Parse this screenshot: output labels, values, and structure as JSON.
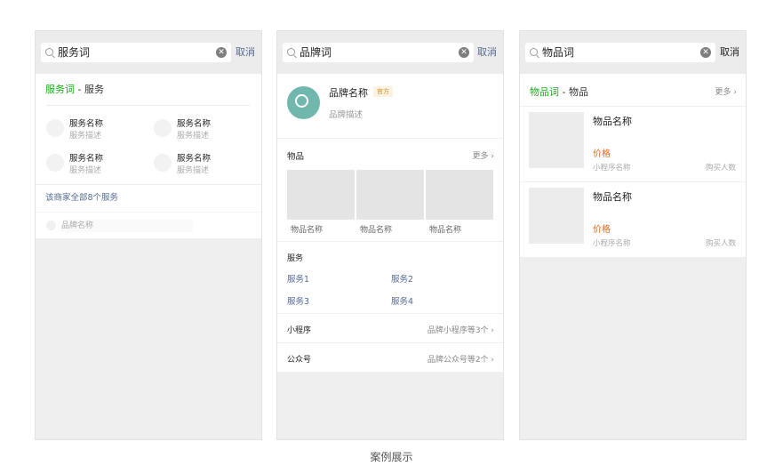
{
  "caption": "案例展示",
  "screen1": {
    "search": {
      "query": "服务词",
      "cancel": "取消"
    },
    "header": {
      "keyword": "服务词",
      "sep": " - ",
      "category": "服务"
    },
    "services": [
      {
        "name": "服务名称",
        "desc": "服务描述"
      },
      {
        "name": "服务名称",
        "desc": "服务描述"
      },
      {
        "name": "服务名称",
        "desc": "服务描述"
      },
      {
        "name": "服务名称",
        "desc": "服务描述"
      }
    ],
    "all_services": "该商家全部8个服务",
    "brand_row": "品牌名称"
  },
  "screen2": {
    "search": {
      "query": "品牌词",
      "cancel": "取消"
    },
    "brand": {
      "name": "品牌名称",
      "badge": "官方",
      "desc": "品牌描述"
    },
    "goods_section": {
      "title": "物品",
      "more": "更多 ›"
    },
    "goods": [
      "物品名称",
      "物品名称",
      "物品名称"
    ],
    "service_section": {
      "title": "服务",
      "items": [
        "服务1",
        "服务2",
        "服务3",
        "服务4"
      ]
    },
    "miniprogram": {
      "label": "小程序",
      "value": "品牌小程序等3个 ›"
    },
    "official": {
      "label": "公众号",
      "value": "品牌公众号等2个 ›"
    }
  },
  "screen3": {
    "search": {
      "query": "物品词",
      "cancel": "取消"
    },
    "header": {
      "keyword": "物品词",
      "sep": " - ",
      "category": "物品",
      "more": "更多 ›"
    },
    "items": [
      {
        "name": "物品名称",
        "price": "价格",
        "mini": "小程序名称",
        "buyers": "购买人数"
      },
      {
        "name": "物品名称",
        "price": "价格",
        "mini": "小程序名称",
        "buyers": "购买人数"
      }
    ]
  }
}
